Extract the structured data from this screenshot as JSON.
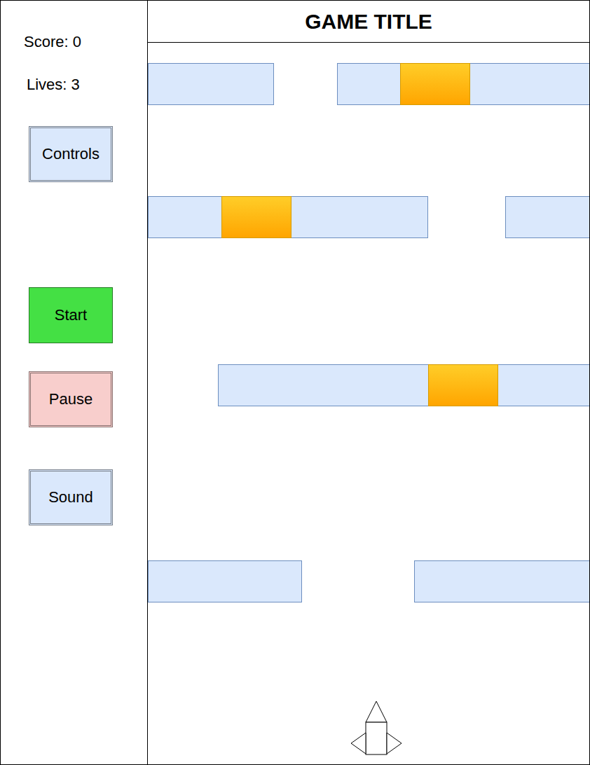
{
  "game": {
    "title": "GAME TITLE"
  },
  "stats": [
    {
      "label": "Score: 0"
    },
    {
      "label": "Lives: 3"
    }
  ],
  "buttons": [
    {
      "label": "Controls",
      "color": "#dae8fc"
    },
    {
      "label": "Start",
      "color": "#44e044"
    },
    {
      "label": "Pause",
      "color": "#f8cecc"
    },
    {
      "label": "Sound",
      "color": "#dae8fc"
    }
  ]
}
